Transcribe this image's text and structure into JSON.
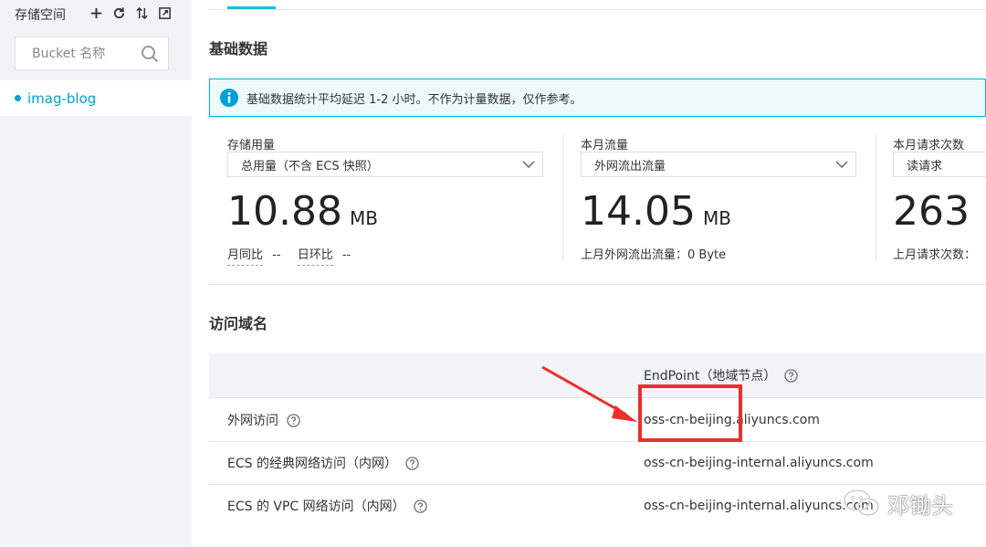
{
  "sidebar": {
    "title": "存储空间",
    "tools": [
      {
        "name": "add-icon"
      },
      {
        "name": "refresh-icon"
      },
      {
        "name": "sort-icon"
      },
      {
        "name": "expand-icon"
      }
    ],
    "search": {
      "placeholder": "Bucket 名称",
      "value": ""
    },
    "buckets": [
      {
        "label": "imag-blog",
        "active": true
      }
    ]
  },
  "basic": {
    "title": "基础数据",
    "notice": "基础数据统计平均延迟 1-2 小时。不作为计量数据，仅作参考。",
    "stats": [
      {
        "label": "存储用量",
        "select": "总用量（不含 ECS 快照）",
        "value": "10.88",
        "unit": "MB",
        "sub": {
          "mom_label": "月同比",
          "mom_value": "--",
          "dod_label": "日环比",
          "dod_value": "--"
        }
      },
      {
        "label": "本月流量",
        "select": "外网流出流量",
        "value": "14.05",
        "unit": "MB",
        "sub": {
          "text": "上月外网流出流量：0 Byte"
        }
      },
      {
        "label": "本月请求次数",
        "select": "读请求",
        "value": "263",
        "unit": "",
        "sub": {
          "text": "上月请求次数："
        }
      }
    ]
  },
  "access": {
    "title": "访问域名",
    "column_header": "EndPoint（地域节点）",
    "rows": [
      {
        "label": "外网访问",
        "endpoint": "oss-cn-beijing.aliyuncs.com"
      },
      {
        "label": "ECS 的经典网络访问（内网）",
        "endpoint": "oss-cn-beijing-internal.aliyuncs.com"
      },
      {
        "label": "ECS 的 VPC 网络访问（内网）",
        "endpoint": "oss-cn-beijing-internal.aliyuncs.com"
      }
    ]
  },
  "watermark": {
    "text": "邓锄头"
  },
  "colors": {
    "accent": "#00a1d6",
    "annotation": "#ee2d2d",
    "notice_border": "#00b3cf"
  }
}
